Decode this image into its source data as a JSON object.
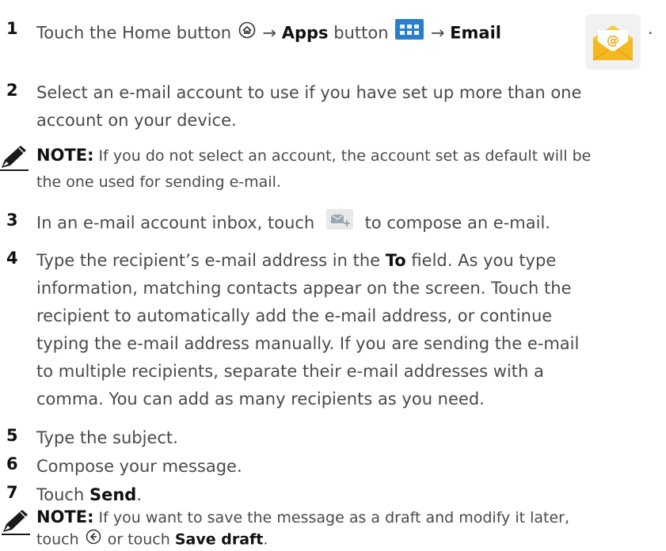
{
  "steps": [
    {
      "num": "1",
      "pre": "Touch the Home button",
      "arrow1": "→",
      "apps": "Apps",
      "button": "button",
      "arrow2": "→",
      "email": "Email",
      "period": "."
    },
    {
      "num": "2",
      "line1": "Select an e-mail account to use if you have set up more than one",
      "line2": "account on your device."
    },
    {
      "num": "3",
      "pre": "In an e-mail account inbox, touch",
      "post": "to compose an e-mail."
    },
    {
      "num": "4",
      "l1_pre": "Type the recipient’s e-mail address in the",
      "l1_to": "To",
      "l1_post": "field. As you type",
      "line2": "information, matching contacts appear on the screen. Touch the",
      "line3": "recipient to automatically add the e-mail address, or continue",
      "line4": "typing the e-mail address manually. If you are sending the e-mail",
      "line5": "to multiple recipients, separate their e-mail addresses with a",
      "line6": "comma. You can add as many recipients as you need."
    },
    {
      "num": "5",
      "text": "Type the subject."
    },
    {
      "num": "6",
      "text": "Compose your message."
    },
    {
      "num": "7",
      "pre": "Touch",
      "send": "Send",
      "period": "."
    }
  ],
  "notes": [
    {
      "label": "NOTE:",
      "line1": "If you do not select an account, the account set as default will be",
      "line2": "the one used for sending e-mail."
    },
    {
      "label": "NOTE:",
      "line1": "If you want to save the message as a draft and modify it later,",
      "l2_pre": "touch",
      "l2_mid": "or touch",
      "l2_bold": "Save draft",
      "l2_end": "."
    }
  ],
  "icons": {
    "home": "home-icon",
    "apps": "apps-grid-icon",
    "email": "email-app-icon",
    "compose": "compose-email-icon",
    "back": "back-icon",
    "note": "note-pen-icon"
  },
  "colors": {
    "body_text": "#4a4a4a",
    "bold_text": "#111111",
    "apps_button": "#2b7ec9",
    "email_envelope": "#f4b922"
  }
}
